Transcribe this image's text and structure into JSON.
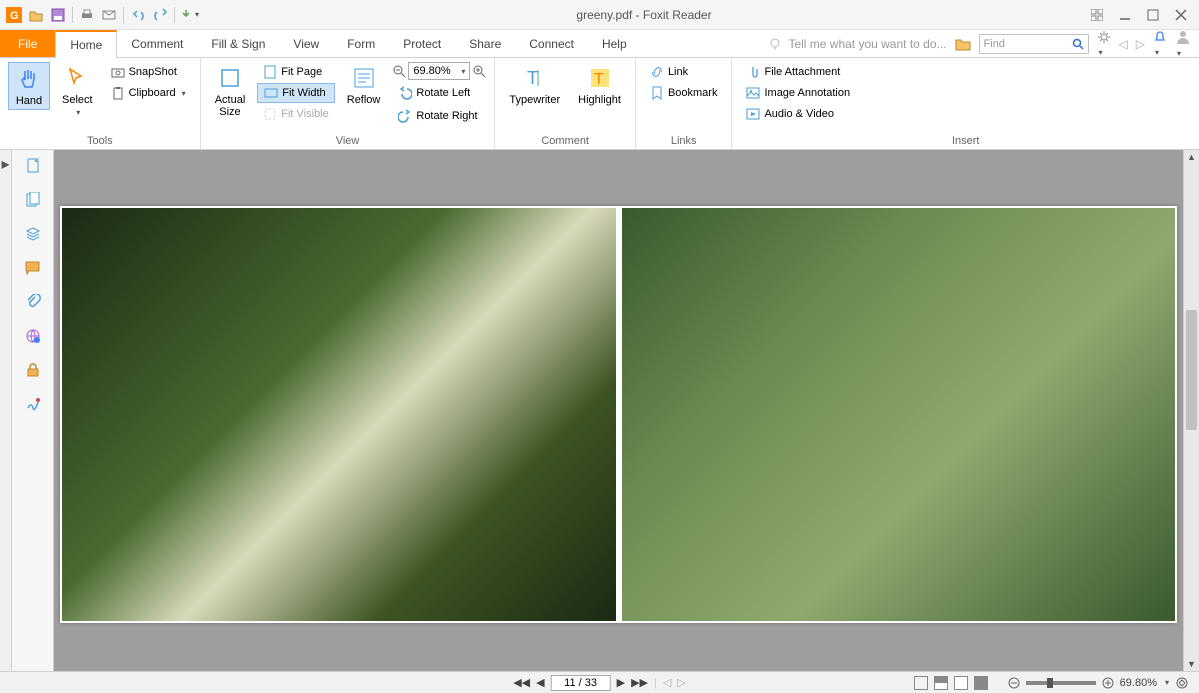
{
  "title": "greeny.pdf - Foxit Reader",
  "qat": {
    "items": [
      "app",
      "open",
      "save",
      "print",
      "mail",
      "undo",
      "redo",
      "quick"
    ]
  },
  "tabs": {
    "file": "File",
    "items": [
      "Home",
      "Comment",
      "Fill & Sign",
      "View",
      "Form",
      "Protect",
      "Share",
      "Connect",
      "Help"
    ],
    "active": "Home"
  },
  "tell_me_placeholder": "Tell me what you want to do...",
  "find_placeholder": "Find",
  "ribbon": {
    "tools": {
      "label": "Tools",
      "hand": "Hand",
      "select": "Select",
      "snapshot": "SnapShot",
      "clipboard": "Clipboard"
    },
    "view": {
      "label": "View",
      "actual_size": "Actual\nSize",
      "fit_page": "Fit Page",
      "fit_width": "Fit Width",
      "fit_visible": "Fit Visible",
      "reflow": "Reflow",
      "zoom_value": "69.80%",
      "rotate_left": "Rotate Left",
      "rotate_right": "Rotate Right"
    },
    "comment": {
      "label": "Comment",
      "typewriter": "Typewriter",
      "highlight": "Highlight"
    },
    "links": {
      "label": "Links",
      "link": "Link",
      "bookmark": "Bookmark"
    },
    "insert": {
      "label": "Insert",
      "file_attachment": "File Attachment",
      "image_annotation": "Image Annotation",
      "audio_video": "Audio & Video"
    }
  },
  "status": {
    "page_display": "11 / 33",
    "zoom_display": "69.80%"
  }
}
